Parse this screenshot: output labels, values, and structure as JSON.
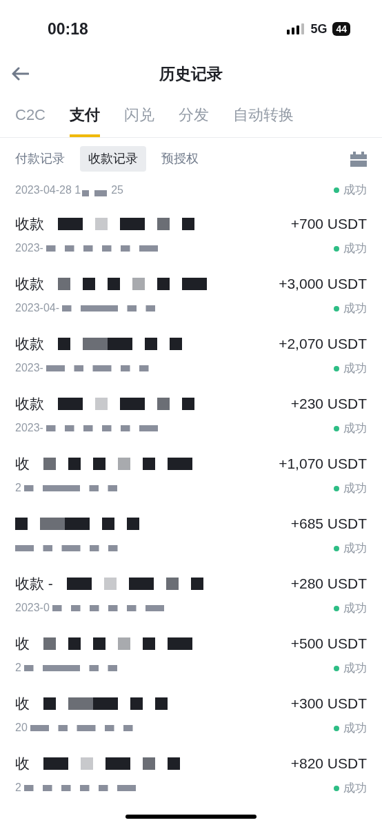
{
  "status_bar": {
    "time": "00:18",
    "network": "5G",
    "battery": "44"
  },
  "header": {
    "title": "历史记录"
  },
  "tabs": [
    {
      "label": "C2C",
      "selected": false
    },
    {
      "label": "支付",
      "selected": true
    },
    {
      "label": "闪兑",
      "selected": false
    },
    {
      "label": "分发",
      "selected": false
    },
    {
      "label": "自动转换",
      "selected": false
    }
  ],
  "sub_tabs": [
    {
      "label": "付款记录",
      "selected": false
    },
    {
      "label": "收款记录",
      "selected": true
    },
    {
      "label": "预授权",
      "selected": false
    }
  ],
  "top_row": {
    "date": "2023-04-28 1",
    "date_end": "25",
    "status": "成功"
  },
  "records": [
    {
      "title": "收款",
      "date": "2023-",
      "amount": "+700 USDT",
      "status": "成功"
    },
    {
      "title": "收款",
      "date": "2023-04-",
      "amount": "+3,000 USDT",
      "status": "成功"
    },
    {
      "title": "收款",
      "date": "2023-",
      "amount": "+2,070 USDT",
      "status": "成功"
    },
    {
      "title": "收款",
      "date": "2023-",
      "amount": "+230 USDT",
      "status": "成功"
    },
    {
      "title": "收",
      "date": "2",
      "amount": "+1,070 USDT",
      "status": "成功"
    },
    {
      "amount": "+685 USDT",
      "status": "成功"
    },
    {
      "title": "收款 -",
      "date": "2023-0",
      "amount": "+280 USDT",
      "status": "成功"
    },
    {
      "title": "收",
      "date": "2",
      "amount": "+500 USDT",
      "status": "成功"
    },
    {
      "title": "收",
      "date": "20",
      "amount": "+300 USDT",
      "status": "成功"
    },
    {
      "title": "收",
      "date": "2",
      "amount": "+820 USDT",
      "status": "成功"
    }
  ]
}
